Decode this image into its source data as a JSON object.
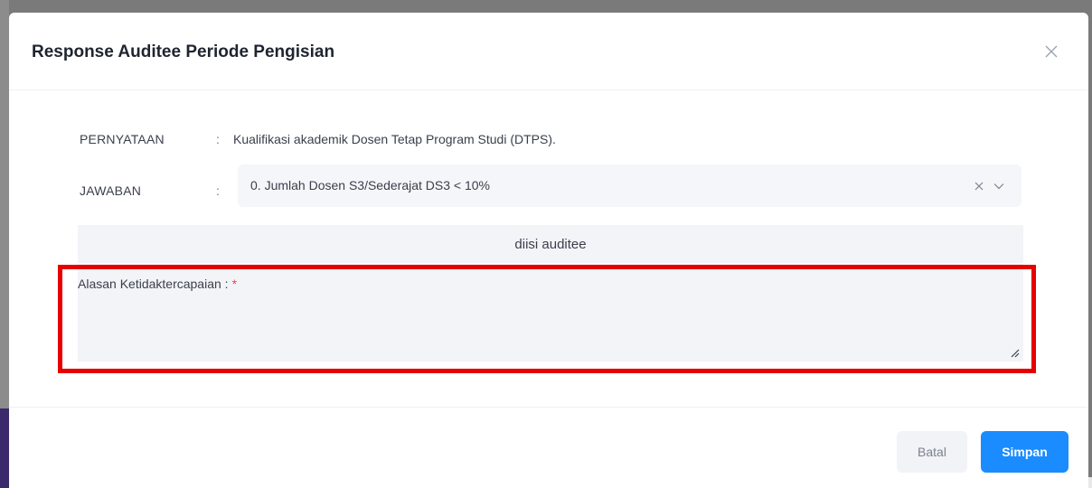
{
  "modal": {
    "title": "Response Auditee Periode Pengisian"
  },
  "form": {
    "pernyataan_label": "PERNYATAAN",
    "pernyataan_colon": ":",
    "pernyataan_value": "Kualifikasi akademik Dosen Tetap Program Studi (DTPS).",
    "jawaban_label": "JAWABAN",
    "jawaban_colon": ":",
    "jawaban_selected": "0. Jumlah Dosen S3/Sederajat DS3 < 10%",
    "section_title": "diisi auditee",
    "alasan_label": "Alasan Ketidaktercapaian :",
    "required_mark": "*",
    "alasan_value": ""
  },
  "footer": {
    "cancel_label": "Batal",
    "save_label": "Simpan"
  },
  "colors": {
    "primary": "#1a8cff",
    "required": "#e5484d",
    "highlight": "#e60000"
  },
  "icons": {
    "close": "close-icon",
    "clear": "clear-icon",
    "chevron": "chevron-down-icon",
    "resize": "resize-handle-icon"
  }
}
